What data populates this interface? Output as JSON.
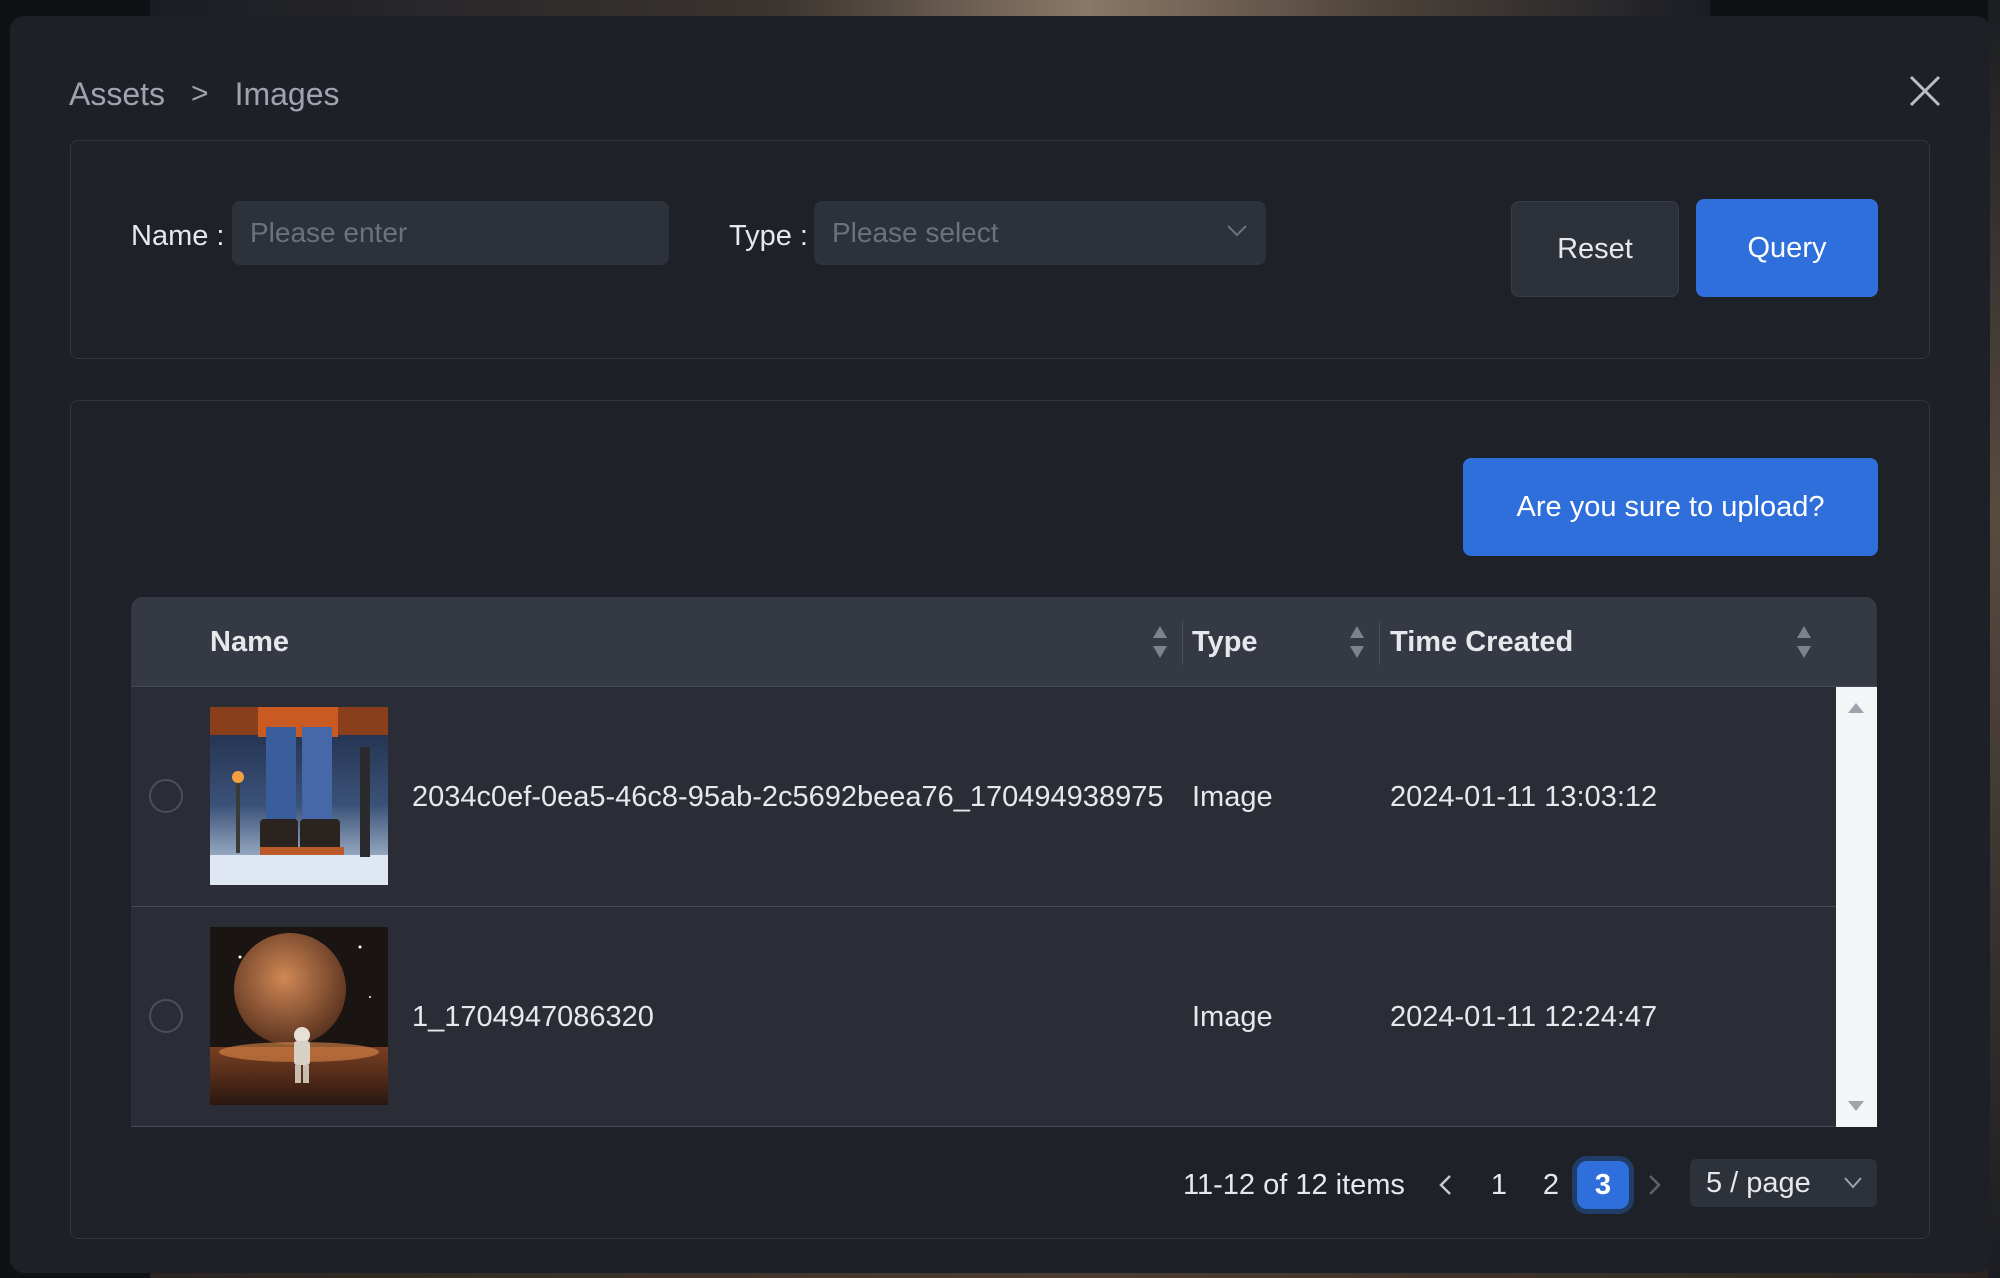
{
  "breadcrumb": {
    "root": "Assets",
    "separator": ">",
    "current": "Images"
  },
  "filters": {
    "name_label": "Name :",
    "name_placeholder": "Please enter",
    "type_label": "Type :",
    "type_placeholder": "Please select",
    "reset_label": "Reset",
    "query_label": "Query"
  },
  "upload_button_label": "Are you sure to upload?",
  "table": {
    "columns": [
      "Name",
      "Type",
      "Time Created"
    ],
    "rows": [
      {
        "name": "2034c0ef-0ea5-46c8-95ab-2c5692beea76_170494938975",
        "type": "Image",
        "time_created": "2024-01-11 13:03:12",
        "thumbnail": "winter-boots-image"
      },
      {
        "name": "1_1704947086320",
        "type": "Image",
        "time_created": "2024-01-11 12:24:47",
        "thumbnail": "astronaut-planet-image"
      }
    ]
  },
  "pagination": {
    "total_text": "11-12 of 12 items",
    "pages": [
      "1",
      "2",
      "3"
    ],
    "current_page": "3",
    "page_size": "5 / page"
  },
  "icons": {
    "close": "close-icon",
    "breadcrumb_separator": "chevron-right-icon",
    "select_chevron": "chevron-down-icon",
    "sort": "sort-icon",
    "prev": "chevron-left-icon",
    "next": "chevron-right-icon"
  },
  "colors": {
    "primary": "#2f6fdb",
    "modal_bg": "#1d2027",
    "input_bg": "#2d313a",
    "table_header_bg": "#353944",
    "table_row_bg": "#2a2d35"
  }
}
